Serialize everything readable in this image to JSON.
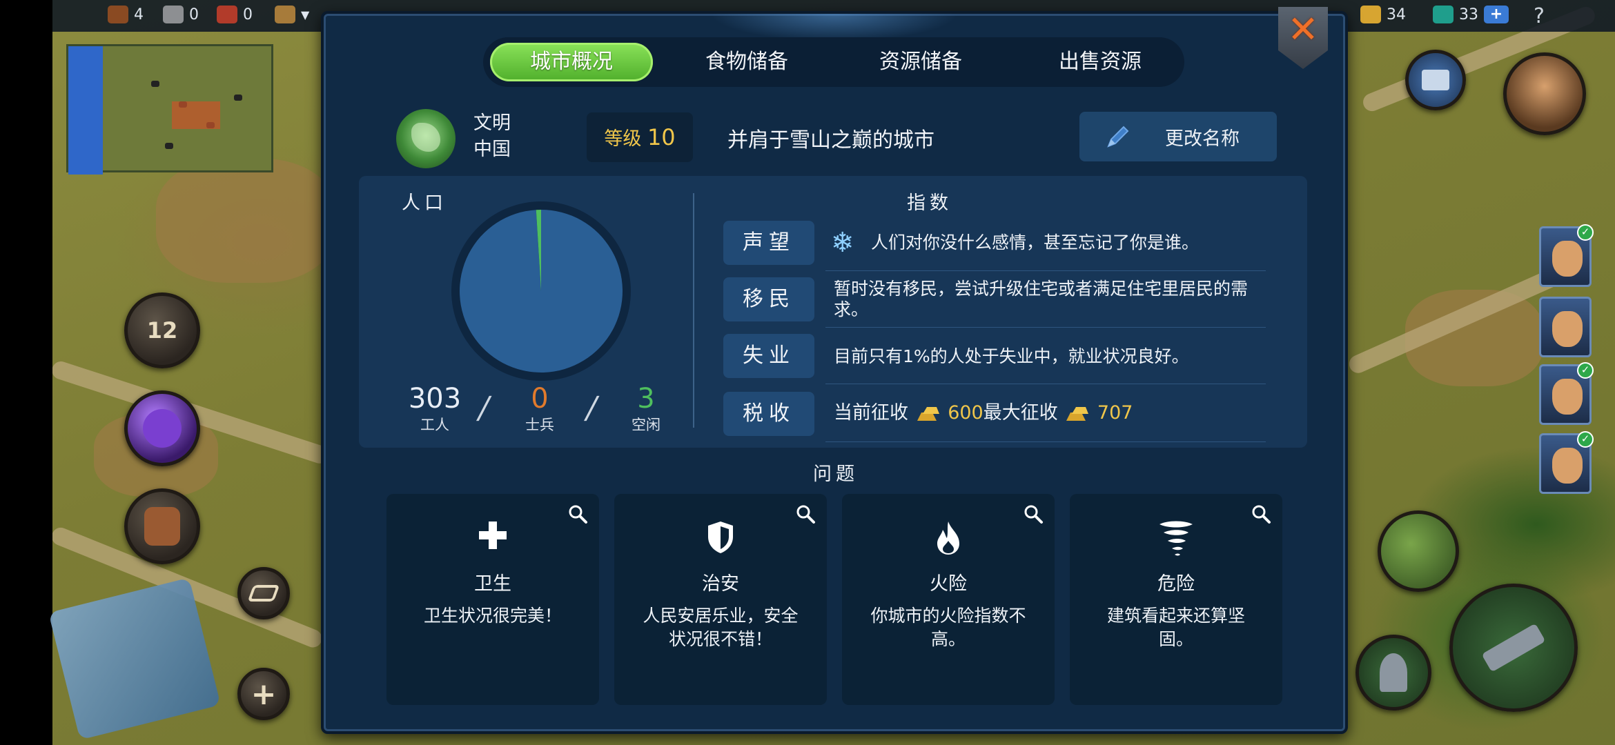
{
  "topbar": {
    "wood": "4",
    "stone": "0",
    "brick": "0",
    "gold": "34",
    "gems": "33",
    "gem_plus": "+",
    "help": "?"
  },
  "side": {
    "calendar_day": "12",
    "add": "+"
  },
  "tabs": [
    {
      "label": "城市概况",
      "active": true
    },
    {
      "label": "食物储备",
      "active": false
    },
    {
      "label": "资源储备",
      "active": false
    },
    {
      "label": "出售资源",
      "active": false
    }
  ],
  "header": {
    "civ_label": "文明",
    "civ_name": "中国",
    "level_label": "等级",
    "level_value": "10",
    "city_name": "并肩于雪山之巅的城市",
    "rename_label": "更改名称"
  },
  "population": {
    "title": "人口",
    "workers_value": "303",
    "workers_label": "工人",
    "soldiers_value": "0",
    "soldiers_label": "士兵",
    "idle_value": "3",
    "idle_label": "空闲",
    "colors": {
      "workers": "#2a5f95",
      "soldiers": "#e07a2c",
      "idle": "#4fbf5e"
    }
  },
  "indices": {
    "title": "指数",
    "rows": [
      {
        "label": "声望",
        "text": "人们对你没什么感情，甚至忘记了你是谁。"
      },
      {
        "label": "移民",
        "text": "暂时没有移民，尝试升级住宅或者满足住宅里居民的需求。"
      },
      {
        "label": "失业",
        "text": "目前只有1%的人处于失业中，就业状况良好。"
      },
      {
        "label": "税收",
        "text_prefix": "当前征收",
        "current": "600",
        "text_mid": "最大征收",
        "max": "707"
      }
    ]
  },
  "problems": {
    "title": "问题",
    "cards": [
      {
        "icon": "plus-icon",
        "name": "卫生",
        "desc": "卫生状况很完美！"
      },
      {
        "icon": "shield-icon",
        "name": "治安",
        "desc": "人民安居乐业，安全状况很不错！"
      },
      {
        "icon": "fire-icon",
        "name": "火险",
        "desc": "你城市的火险指数不高。"
      },
      {
        "icon": "tornado-icon",
        "name": "危险",
        "desc": "建筑看起来还算坚固。"
      }
    ]
  },
  "colors": {
    "panel": "#102a45",
    "tab_active": "#5fc33a",
    "gold_text": "#f0c64a",
    "soldiers": "#e07a2c",
    "idle": "#4fbf5e"
  }
}
